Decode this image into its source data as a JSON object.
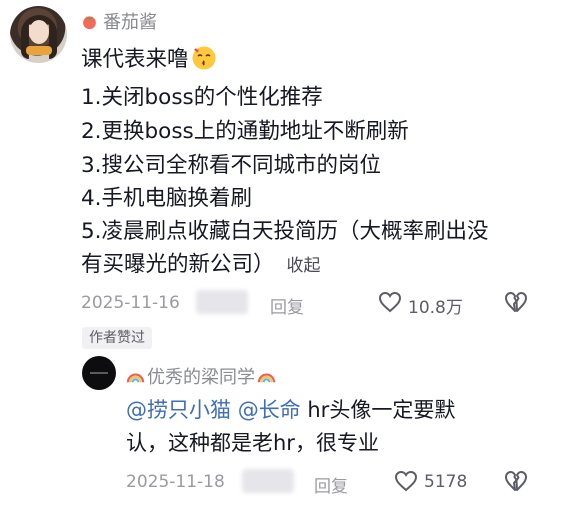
{
  "comment": {
    "username": "番茄酱",
    "lines": [
      "课代表来噜",
      "1.关闭boss的个性化推荐",
      "2.更换boss上的通勤地址不断刷新",
      "3.搜公司全称看不同城市的岗位",
      "4.手机电脑换着刷",
      "5.凌晨刷点收藏白天投简历（大概率刷出没",
      "有买曝光的新公司）"
    ],
    "collapse_label": "收起",
    "date": "2025-11-16",
    "reply_label": "回复",
    "like_count": "10.8万",
    "author_badge": "作者赞过"
  },
  "reply": {
    "username": "优秀的梁同学",
    "mention_1": "@捞只小猫",
    "mention_2": "@长命",
    "text_line1": "hr头像一定要默",
    "text_line2": "认，这种都是老hr，很专业",
    "date": "2025-11-18",
    "reply_label": "回复",
    "like_count": "5178"
  },
  "icons": {
    "tomato": "tomato-icon",
    "emoji": "kissing-face-emoji",
    "rainbow": "rainbow-icon",
    "heart": "heart-outline-icon",
    "dislike": "broken-heart-icon"
  }
}
